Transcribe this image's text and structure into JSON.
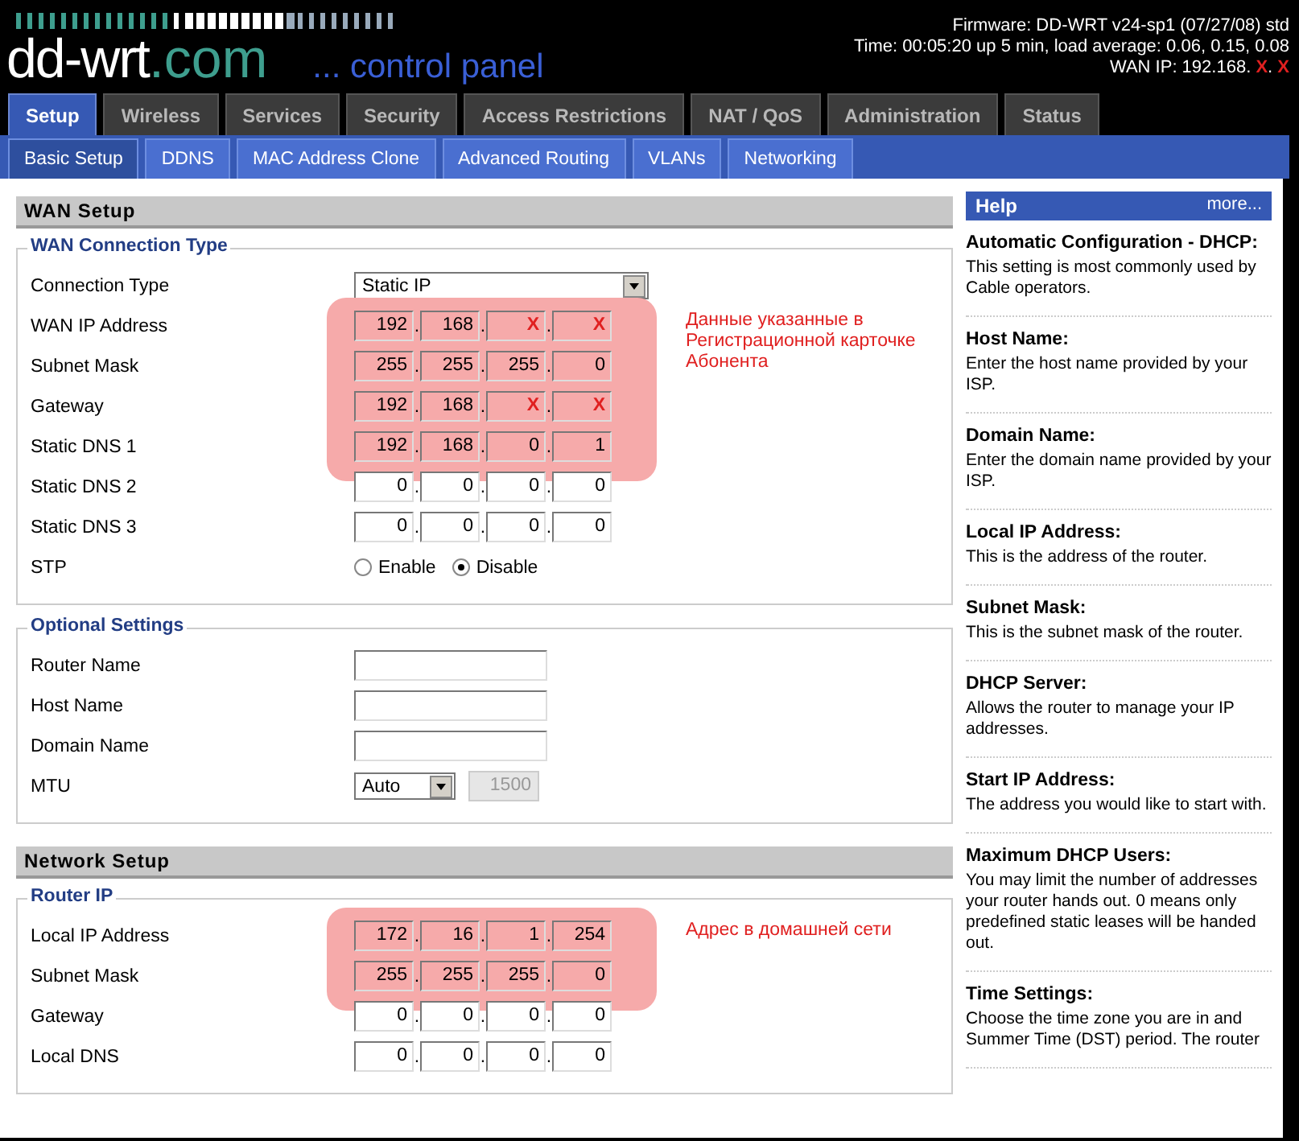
{
  "header": {
    "logo_main": "dd-wrt",
    "logo_suffix": ".com",
    "tagline": "... control panel",
    "firmware": "Firmware: DD-WRT v24-sp1 (07/27/08) std",
    "time": "Time: 00:05:20 up 5 min, load average: 0.06, 0.15, 0.08",
    "wan_ip_label": "WAN IP: 192.168.",
    "wan_ip_masked": [
      "X",
      "X"
    ],
    "wan_ip_separator": "."
  },
  "ip_separator": ".",
  "tabs": [
    {
      "label": "Setup",
      "selected": true
    },
    {
      "label": "Wireless",
      "selected": false
    },
    {
      "label": "Services",
      "selected": false
    },
    {
      "label": "Security",
      "selected": false
    },
    {
      "label": "Access Restrictions",
      "selected": false
    },
    {
      "label": "NAT / QoS",
      "selected": false
    },
    {
      "label": "Administration",
      "selected": false
    },
    {
      "label": "Status",
      "selected": false
    }
  ],
  "subtabs": [
    {
      "label": "Basic Setup",
      "selected": true
    },
    {
      "label": "DDNS",
      "selected": false
    },
    {
      "label": "MAC Address Clone",
      "selected": false
    },
    {
      "label": "Advanced Routing",
      "selected": false
    },
    {
      "label": "VLANs",
      "selected": false
    },
    {
      "label": "Networking",
      "selected": false
    }
  ],
  "sections": [
    {
      "title": "WAN Setup",
      "fieldsets": [
        {
          "legend": "WAN Connection Type",
          "rows": [
            {
              "kind": "select",
              "label": "Connection Type",
              "value": "Static IP"
            },
            {
              "kind": "ip",
              "label": "WAN IP Address",
              "highlighted": true,
              "note": "Данные указанные в Регистрационной карточке Абонента",
              "octets": [
                "192",
                "168",
                {
                  "value": "X",
                  "redacted": true
                },
                {
                  "value": "X",
                  "redacted": true
                }
              ]
            },
            {
              "kind": "ip",
              "label": "Subnet Mask",
              "highlighted": true,
              "octets": [
                "255",
                "255",
                "255",
                "0"
              ]
            },
            {
              "kind": "ip",
              "label": "Gateway",
              "highlighted": true,
              "octets": [
                "192",
                "168",
                {
                  "value": "X",
                  "redacted": true
                },
                {
                  "value": "X",
                  "redacted": true
                }
              ]
            },
            {
              "kind": "ip",
              "label": "Static DNS 1",
              "highlighted": true,
              "octets": [
                "192",
                "168",
                "0",
                "1"
              ]
            },
            {
              "kind": "ip",
              "label": "Static DNS 2",
              "highlighted": false,
              "octets": [
                "0",
                "0",
                "0",
                "0"
              ]
            },
            {
              "kind": "ip",
              "label": "Static DNS 3",
              "highlighted": false,
              "octets": [
                "0",
                "0",
                "0",
                "0"
              ]
            },
            {
              "kind": "radio",
              "label": "STP",
              "options": [
                {
                  "label": "Enable",
                  "selected": false
                },
                {
                  "label": "Disable",
                  "selected": true
                }
              ]
            }
          ]
        },
        {
          "legend": "Optional Settings",
          "rows": [
            {
              "kind": "text",
              "label": "Router Name"
            },
            {
              "kind": "text",
              "label": "Host Name"
            },
            {
              "kind": "text",
              "label": "Domain Name"
            },
            {
              "kind": "mtu",
              "label": "MTU",
              "value": "Auto",
              "size": "1500",
              "size_disabled": true
            }
          ]
        }
      ]
    },
    {
      "title": "Network Setup",
      "fieldsets": [
        {
          "legend": "Router IP",
          "rows": [
            {
              "kind": "ip",
              "label": "Local IP Address",
              "highlighted": true,
              "note": "Адрес в домашней сети",
              "octets": [
                "172",
                "16",
                "1",
                "254"
              ]
            },
            {
              "kind": "ip",
              "label": "Subnet Mask",
              "highlighted": true,
              "octets": [
                "255",
                "255",
                "255",
                "0"
              ]
            },
            {
              "kind": "ip",
              "label": "Gateway",
              "highlighted": false,
              "octets": [
                "0",
                "0",
                "0",
                "0"
              ]
            },
            {
              "kind": "ip",
              "label": "Local DNS",
              "highlighted": false,
              "octets": [
                "0",
                "0",
                "0",
                "0"
              ]
            }
          ]
        }
      ]
    }
  ],
  "help": {
    "title": "Help",
    "more": "more...",
    "items": [
      {
        "heading": "Automatic Configuration - DHCP:",
        "text": "This setting is most commonly used by Cable operators."
      },
      {
        "heading": "Host Name:",
        "text": "Enter the host name provided by your ISP."
      },
      {
        "heading": "Domain Name:",
        "text": "Enter the domain name provided by your ISP."
      },
      {
        "heading": "Local IP Address:",
        "text": "This is the address of the router."
      },
      {
        "heading": "Subnet Mask:",
        "text": "This is the subnet mask of the router."
      },
      {
        "heading": "DHCP Server:",
        "text": "Allows the router to manage your IP addresses."
      },
      {
        "heading": "Start IP Address:",
        "text": "The address you would like to start with."
      },
      {
        "heading": "Maximum DHCP Users:",
        "text": "You may limit the number of addresses your router hands out. 0 means only predefined static leases will be handed out."
      },
      {
        "heading": "Time Settings:",
        "text": "Choose the time zone you are in and Summer Time (DST) period. The router"
      }
    ]
  }
}
